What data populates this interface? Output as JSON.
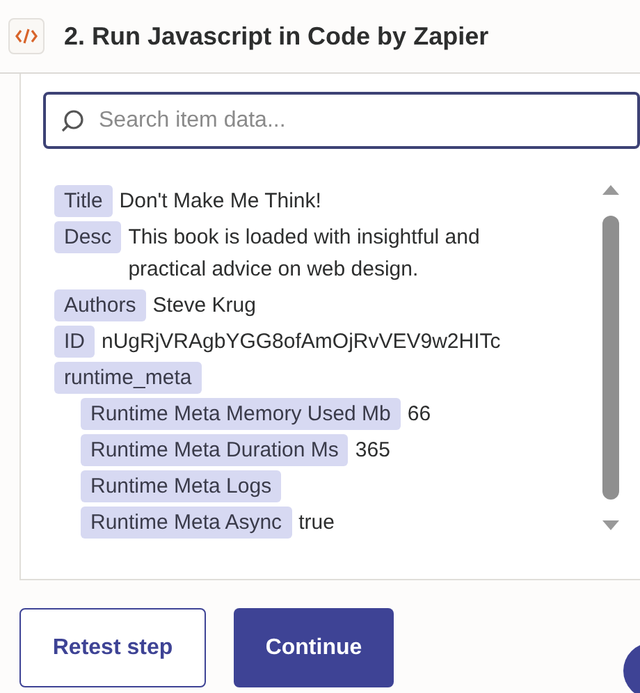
{
  "header": {
    "title": "2. Run Javascript in Code by Zapier"
  },
  "search": {
    "placeholder": "Search item data..."
  },
  "fields": [
    {
      "label": "Title",
      "value": "Don't Make Me Think!"
    },
    {
      "label": "Desc",
      "value": "This book is loaded with insightful and practical advice on web design."
    },
    {
      "label": "Authors",
      "value": "Steve Krug"
    },
    {
      "label": "ID",
      "value": "nUgRjVRAgbYGG8ofAmOjRvVEV9w2HITc"
    },
    {
      "label": "runtime_meta",
      "children": [
        {
          "label": "Runtime Meta Memory Used Mb",
          "value": "66"
        },
        {
          "label": "Runtime Meta Duration Ms",
          "value": "365"
        },
        {
          "label": "Runtime Meta Logs"
        },
        {
          "label": "Runtime Meta Async",
          "value": "true"
        }
      ]
    }
  ],
  "buttons": [
    {
      "label": "Retest step",
      "kind": "secondary"
    },
    {
      "label": "Continue",
      "kind": "primary"
    }
  ]
}
